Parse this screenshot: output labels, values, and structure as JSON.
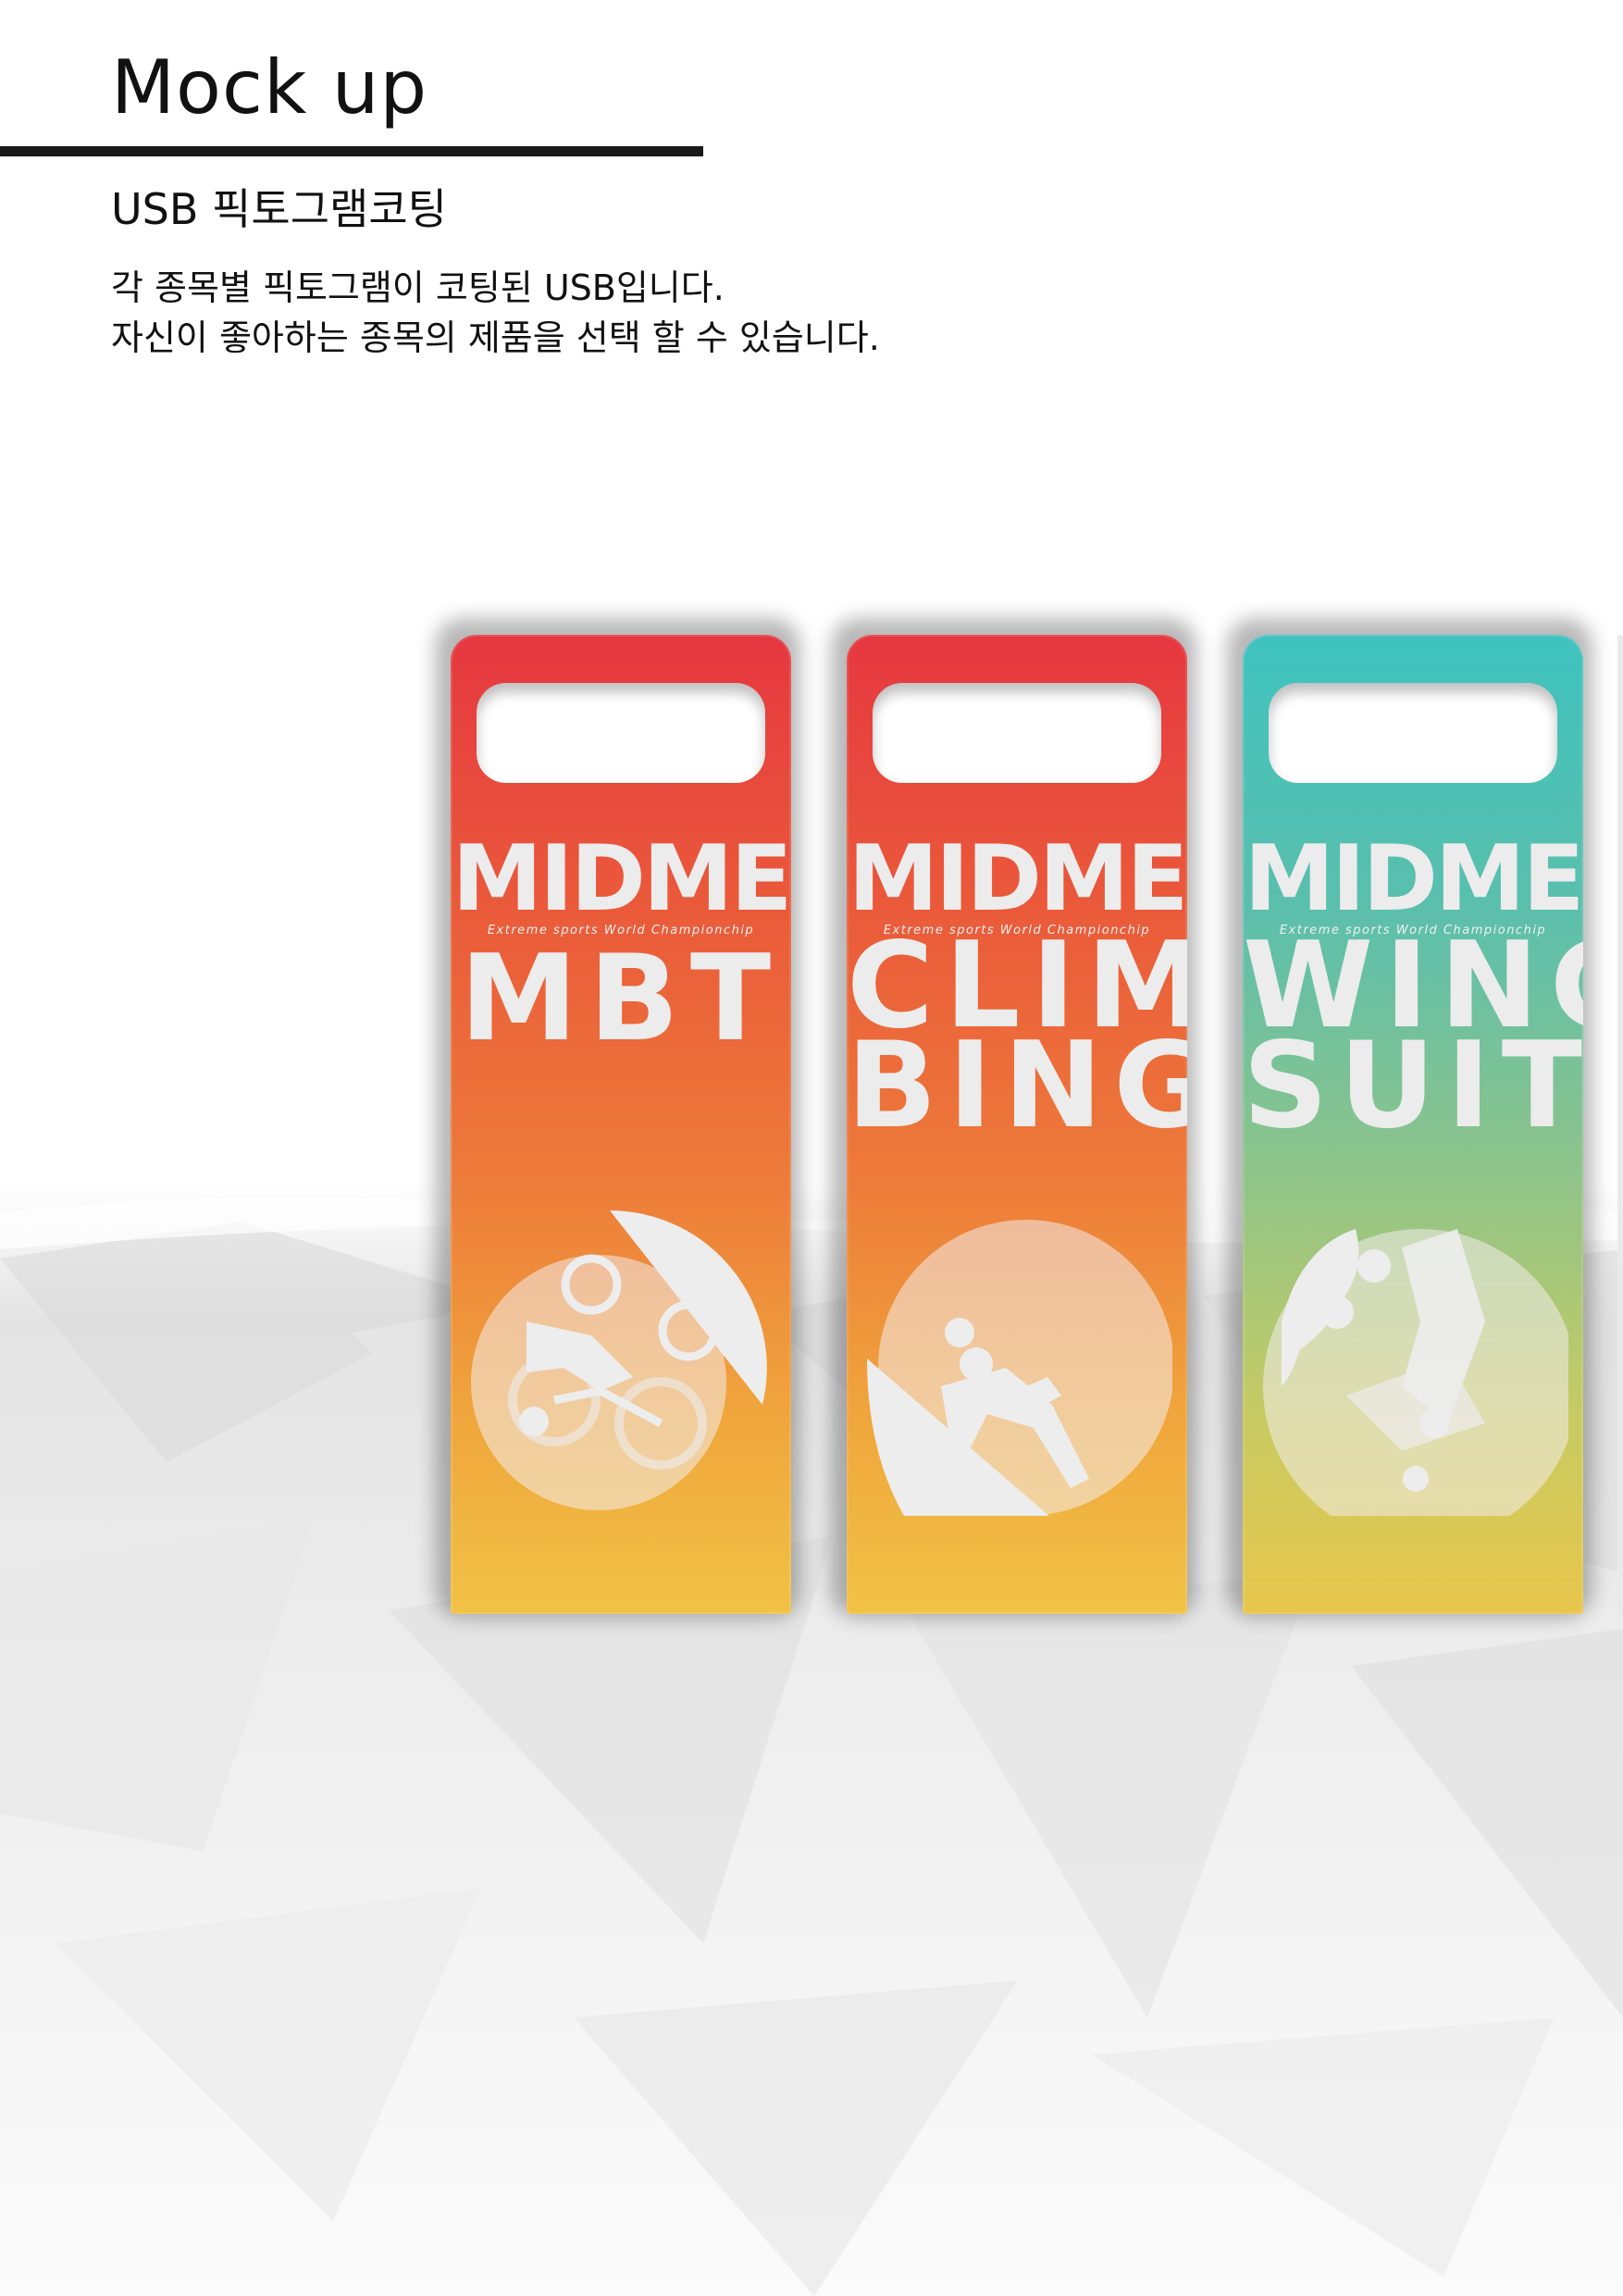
{
  "header": {
    "title": "Mock up",
    "subtitle": "USB 픽토그램코팅",
    "description": [
      "각 종목별 픽토그램이 코팅된 USB입니다.",
      "자신이 좋아하는 종목의 제품을 선택 할 수 있습니다."
    ]
  },
  "usbs": [
    {
      "brand": "MIDME",
      "tagline": "Extreme sports World Championchip",
      "sport_lines": [
        "MBT"
      ],
      "color": "#e8463d",
      "icon": "mountain-bike-icon"
    },
    {
      "brand": "MIDME",
      "tagline": "Extreme sports World Championchip",
      "sport_lines": [
        "CLIM",
        "BING"
      ],
      "color": "#e8463d",
      "icon": "climbing-icon"
    },
    {
      "brand": "MIDME",
      "tagline": "Extreme sports World Championchip",
      "sport_lines": [
        "WING",
        "SUIT"
      ],
      "color": "#49c2b9",
      "icon": "wingsuit-icon"
    }
  ]
}
